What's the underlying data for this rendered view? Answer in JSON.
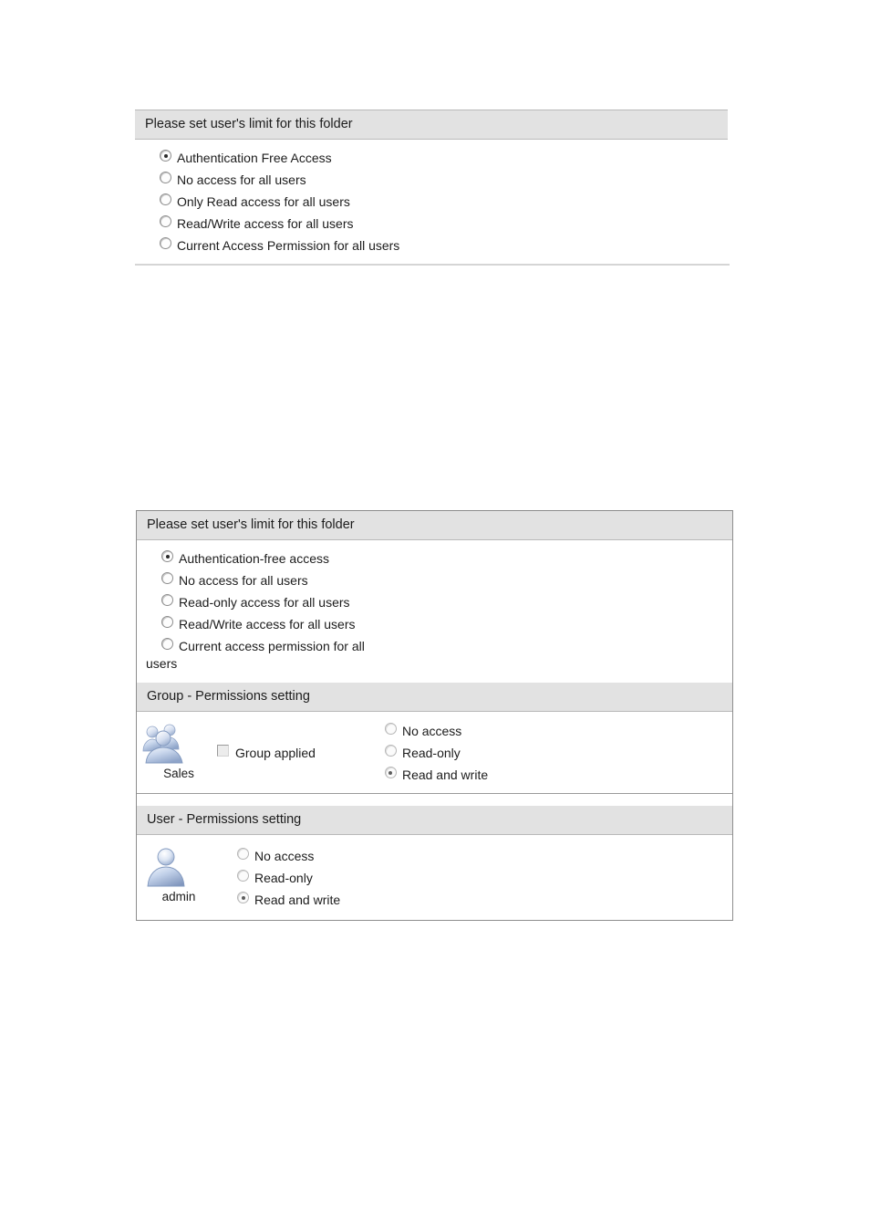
{
  "colors": {
    "header_bg": "#e2e2e2",
    "panel_border": "#8d8d8d",
    "text": "#1c1c1c",
    "icon_blue": "#a8bcdd"
  },
  "panel_one": {
    "header": "Please set user's limit for this folder",
    "options": [
      {
        "label": "Authentication Free Access",
        "selected": true
      },
      {
        "label": "No access for all users",
        "selected": false
      },
      {
        "label": "Only Read access for all users",
        "selected": false
      },
      {
        "label": "Read/Write access for all users",
        "selected": false
      },
      {
        "label": "Current Access Permission for all users",
        "selected": false
      }
    ]
  },
  "panel_two": {
    "folder_section": {
      "header": "Please set user's limit for this folder",
      "options": [
        {
          "label": "Authentication-free access",
          "selected": true
        },
        {
          "label": "No access for all users",
          "selected": false
        },
        {
          "label": "Read-only access for all users",
          "selected": false
        },
        {
          "label": "Read/Write access for all users",
          "selected": false
        },
        {
          "label": "Current access permission for all",
          "selected": false
        }
      ],
      "wrapped_tail": "users"
    },
    "group_section": {
      "header": "Group - Permissions setting",
      "icon": "group-icon",
      "group_name": "Sales",
      "applied_checkbox": {
        "label": "Group applied",
        "checked": false
      },
      "options": [
        {
          "label": "No access",
          "selected": false
        },
        {
          "label": "Read-only",
          "selected": false
        },
        {
          "label": "Read and write",
          "selected": true
        }
      ]
    },
    "user_section": {
      "header": "User - Permissions setting",
      "icon": "user-icon",
      "user_name": "admin",
      "options": [
        {
          "label": "No access",
          "selected": false
        },
        {
          "label": "Read-only",
          "selected": false
        },
        {
          "label": "Read and write",
          "selected": true
        }
      ]
    }
  }
}
